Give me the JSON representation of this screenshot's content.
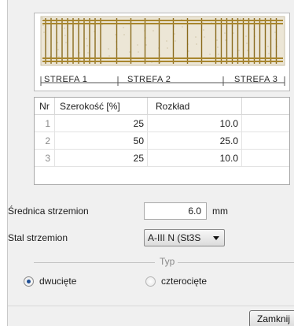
{
  "beam": {
    "zones": [
      "STREFA 1",
      "STREFA 2",
      "STREFA 3"
    ]
  },
  "table": {
    "columns": [
      "Nr",
      "Szerokość [%]",
      "Rozkład"
    ],
    "rows": [
      {
        "nr": "1",
        "width": "25",
        "spacing": "10.0"
      },
      {
        "nr": "2",
        "width": "50",
        "spacing": "25.0"
      },
      {
        "nr": "3",
        "width": "25",
        "spacing": "10.0"
      }
    ]
  },
  "diameter": {
    "label": "Średnica strzemion",
    "value": "6.0",
    "unit": "mm"
  },
  "steel": {
    "label": "Stal strzemion",
    "value": "A-III N (St3S"
  },
  "type_group": {
    "title": "Typ",
    "options": [
      {
        "label": "dwucięte",
        "selected": true
      },
      {
        "label": "czterocięte",
        "selected": false
      }
    ]
  },
  "close_label": "Zamknij",
  "colors": {
    "rebar": "#a8862e",
    "stirrup": "#8a6a1c",
    "window": "#f0f0f0",
    "radio": "#1f4e94"
  }
}
